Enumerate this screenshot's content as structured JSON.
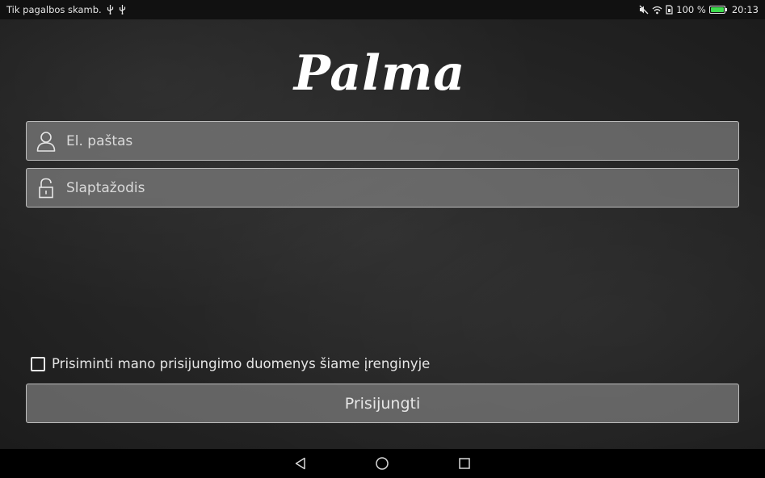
{
  "status_bar": {
    "carrier_text": "Tik pagalbos skamb.",
    "battery_percent": "100 %",
    "time": "20:13",
    "icons": [
      "usb-icon",
      "usb-icon",
      "mute-icon",
      "wifi-icon",
      "sim-icon",
      "battery-icon"
    ],
    "battery_color": "#3ddc4d"
  },
  "app": {
    "logo_text": "Palma"
  },
  "login_form": {
    "email_placeholder": "El. paštas",
    "email_value": "",
    "password_placeholder": "Slaptažodis",
    "password_value": "",
    "remember_label": "Prisiminti mano prisijungimo duomenys šiame įrenginyje",
    "remember_checked": false,
    "submit_label": "Prisijungti"
  },
  "nav_bar": {
    "buttons": [
      "back-icon",
      "home-icon",
      "recents-icon"
    ]
  }
}
